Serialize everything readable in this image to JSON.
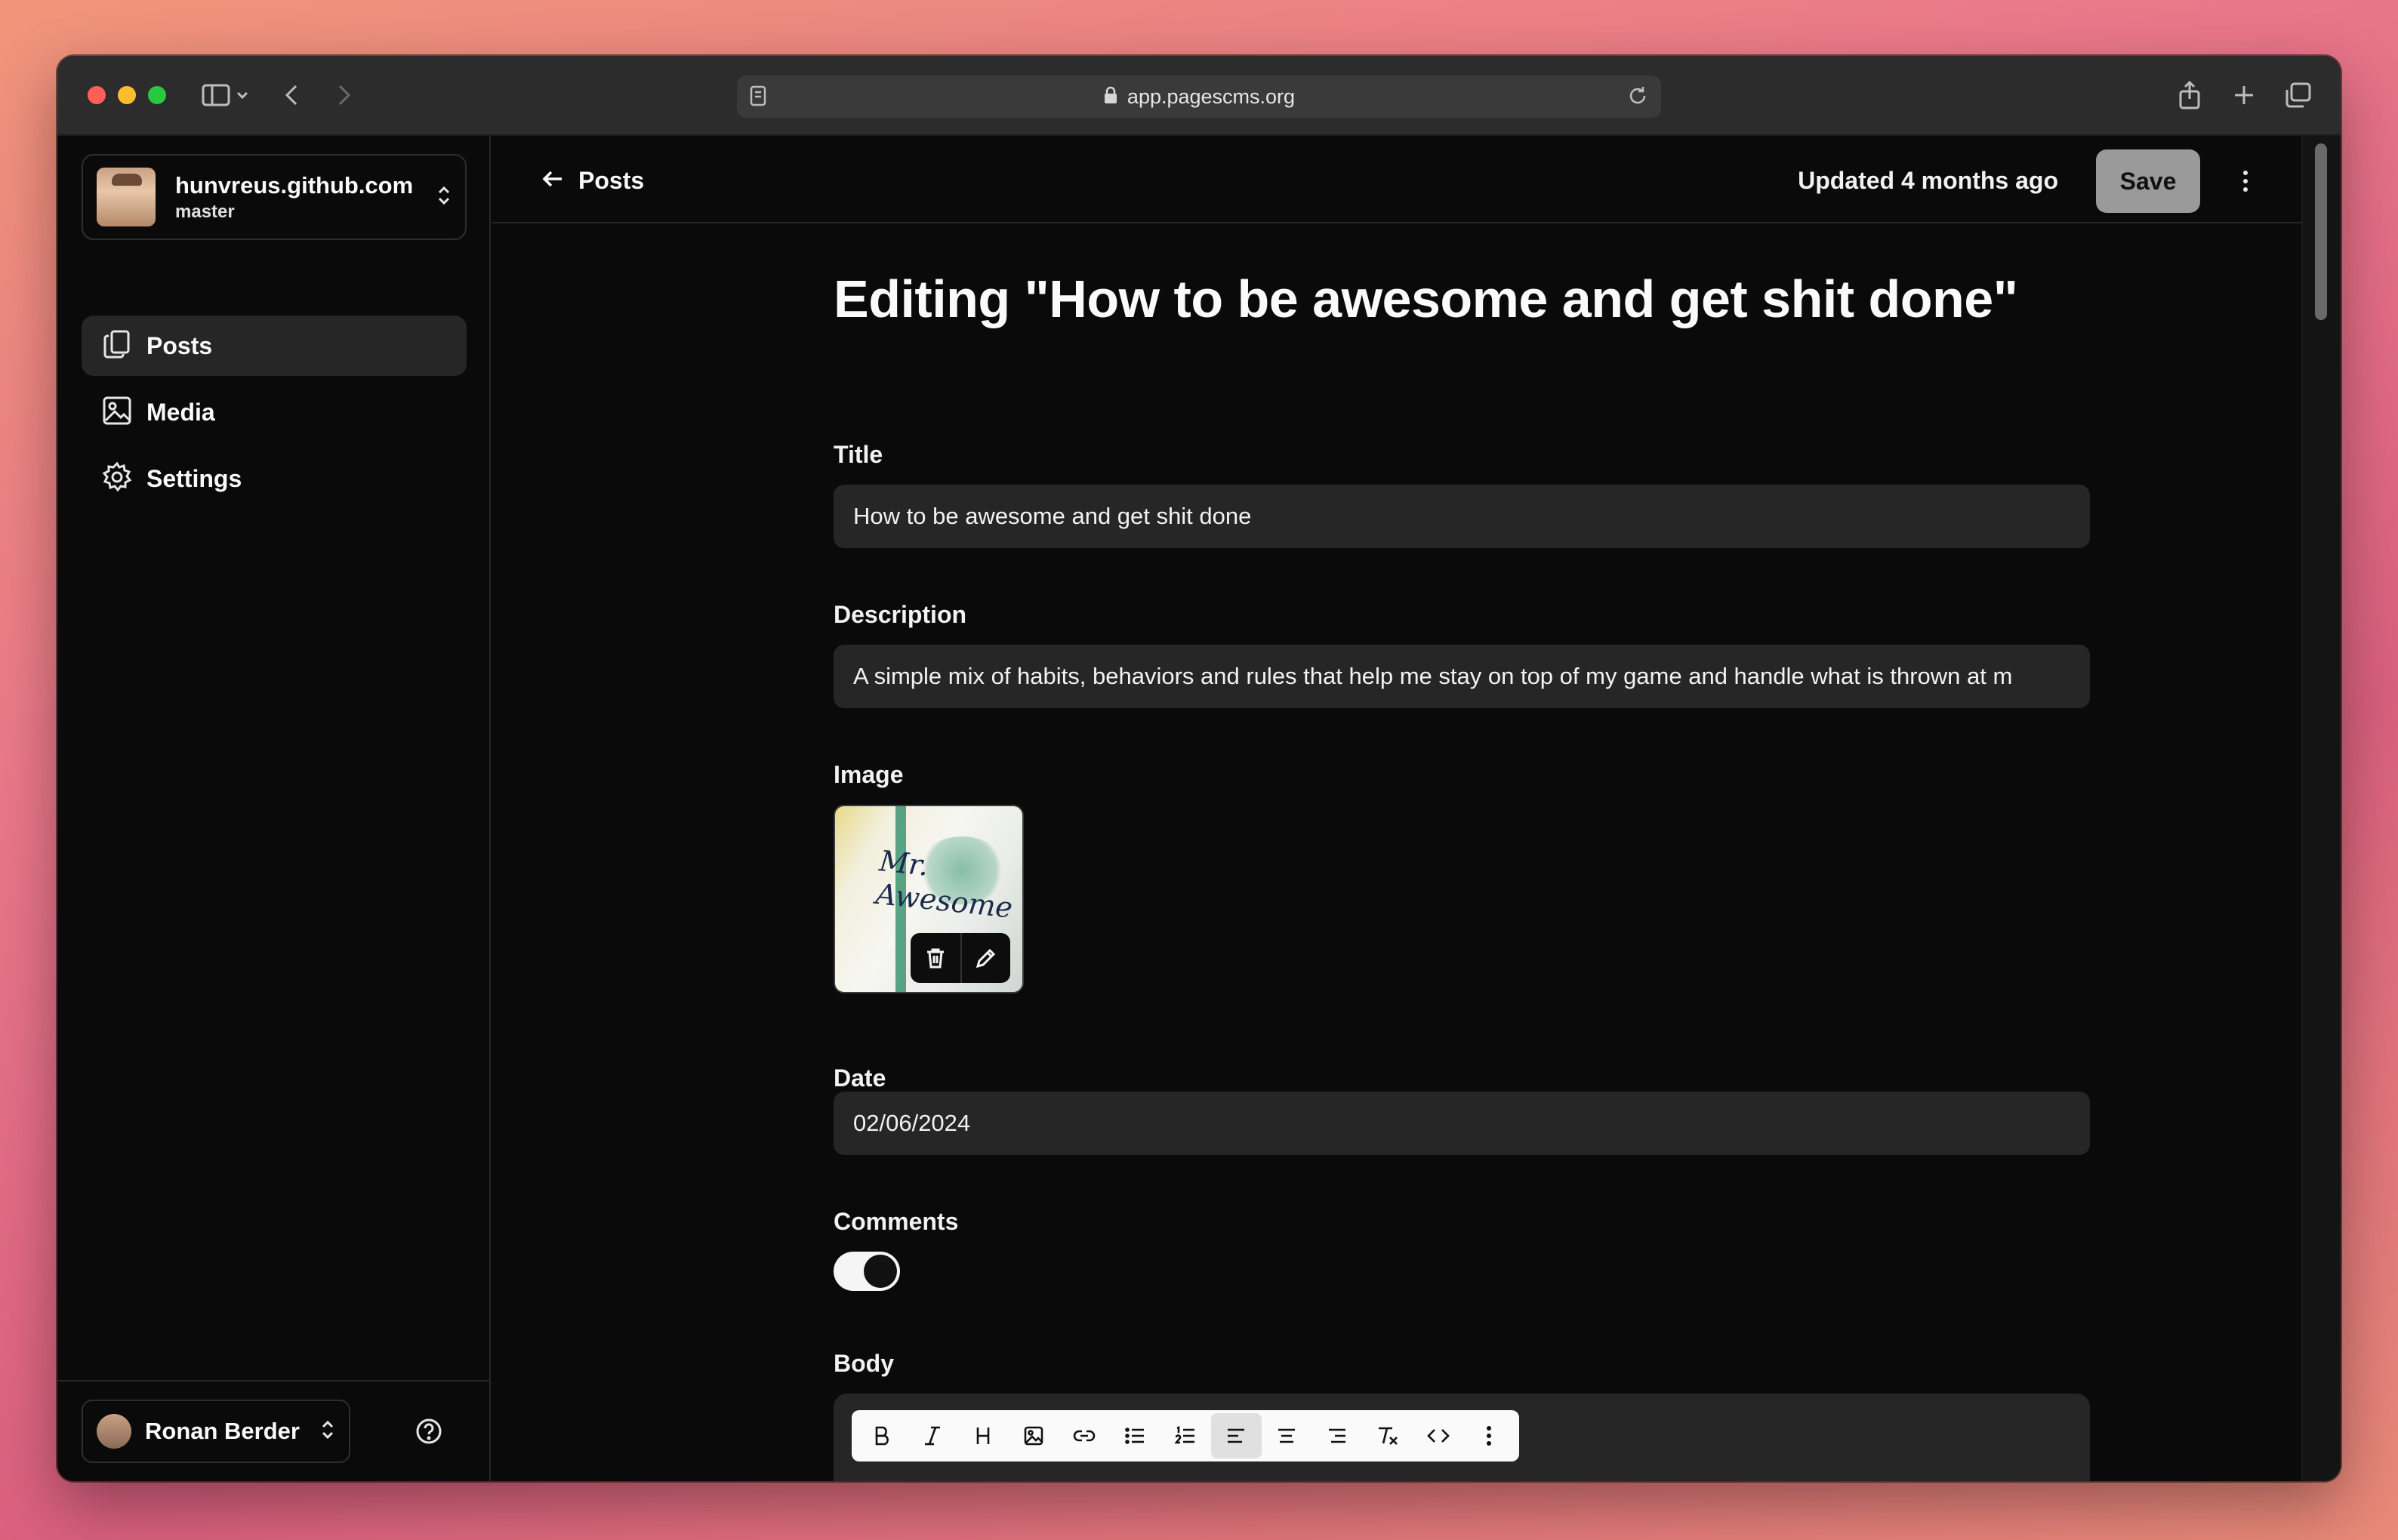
{
  "browser": {
    "url": "app.pagescms.org"
  },
  "sidebar": {
    "repo": {
      "name": "hunvreus.github.com",
      "branch": "master"
    },
    "items": [
      {
        "label": "Posts",
        "icon": "files-icon",
        "active": true
      },
      {
        "label": "Media",
        "icon": "image-icon",
        "active": false
      },
      {
        "label": "Settings",
        "icon": "gear-icon",
        "active": false
      }
    ],
    "user": {
      "name": "Ronan Berder"
    }
  },
  "header": {
    "back_label": "Posts",
    "updated": "Updated 4 months ago",
    "save_label": "Save"
  },
  "form": {
    "page_title": "Editing \"How to be awesome and get shit done\"",
    "title": {
      "label": "Title",
      "value": "How to be awesome and get shit done"
    },
    "description": {
      "label": "Description",
      "value": "A simple mix of habits, behaviors and rules that help me stay on top of my game and handle what is thrown at m"
    },
    "image": {
      "label": "Image",
      "caption": "Mr. Awesome"
    },
    "date": {
      "label": "Date",
      "value": "02/06/2024"
    },
    "comments": {
      "label": "Comments",
      "enabled": true
    },
    "body": {
      "label": "Body",
      "toolbar": [
        "bold",
        "italic",
        "heading",
        "image",
        "link",
        "bullet-list",
        "ordered-list",
        "align-left",
        "align-center",
        "align-right",
        "clear-format",
        "code",
        "more"
      ],
      "active_tool": "align-left"
    }
  },
  "colors": {
    "background": "#0a0a0a",
    "input": "#262626",
    "save_button": "#9a9a9a",
    "text": "#fafafa"
  }
}
